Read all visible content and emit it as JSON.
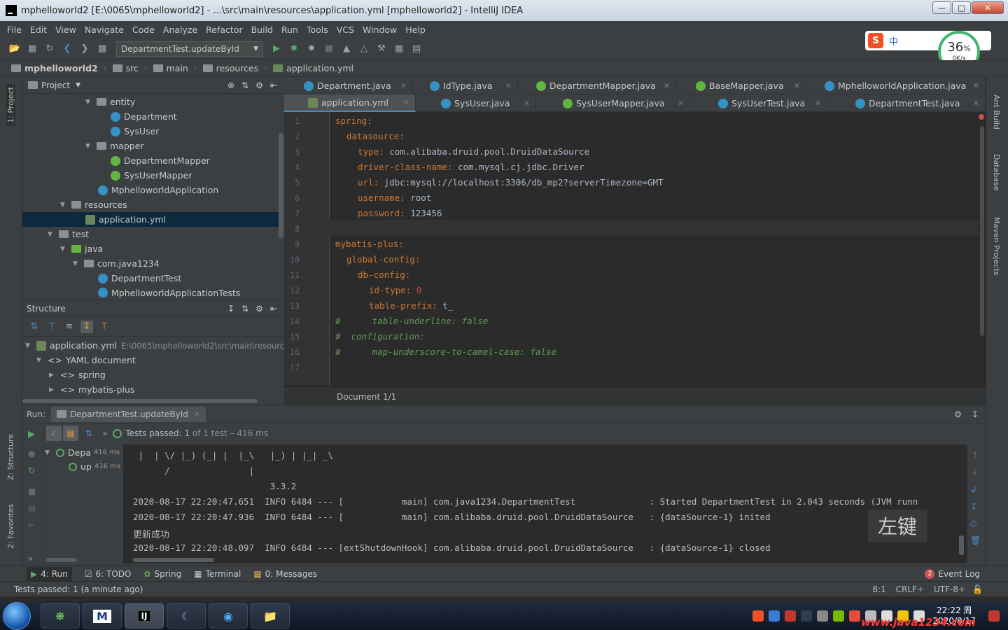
{
  "window": {
    "title": "mphelloworld2 [E:\\0065\\mphelloworld2] - ...\\src\\main\\resources\\application.yml [mphelloworld2] - IntelliJ IDEA",
    "min": "—",
    "max": "□",
    "close": "✕"
  },
  "menu": [
    "File",
    "Edit",
    "View",
    "Navigate",
    "Code",
    "Analyze",
    "Refactor",
    "Build",
    "Run",
    "Tools",
    "VCS",
    "Window",
    "Help"
  ],
  "toolbar": {
    "run_config": "DepartmentTest.updateById"
  },
  "breadcrumb": [
    "mphelloworld2",
    "src",
    "main",
    "resources",
    "application.yml"
  ],
  "left_strip": {
    "project": "1: Project",
    "structure": "Z: Structure",
    "favorites": "2: Favorites"
  },
  "right_strip": {
    "ant": "Ant Build",
    "database": "Database",
    "maven": "Maven Projects"
  },
  "project_panel": {
    "title": "Project",
    "tree": [
      {
        "label": "entity",
        "type": "folder"
      },
      {
        "label": "Department",
        "type": "class"
      },
      {
        "label": "SysUser",
        "type": "class"
      },
      {
        "label": "mapper",
        "type": "folder"
      },
      {
        "label": "DepartmentMapper",
        "type": "interface"
      },
      {
        "label": "SysUserMapper",
        "type": "interface"
      },
      {
        "label": "MphelloworldApplication",
        "type": "class"
      },
      {
        "label": "resources",
        "type": "folder"
      },
      {
        "label": "application.yml",
        "type": "yml"
      },
      {
        "label": "test",
        "type": "folder"
      },
      {
        "label": "java",
        "type": "folder"
      },
      {
        "label": "com.java1234",
        "type": "folder"
      },
      {
        "label": "DepartmentTest",
        "type": "class"
      },
      {
        "label": "MphelloworldApplicationTests",
        "type": "class"
      }
    ]
  },
  "structure_panel": {
    "title": "Structure",
    "root_label": "application.yml",
    "root_path": "E:\\0065\\mphelloworld2\\src\\main\\resourc",
    "doc": "YAML document",
    "children": [
      "spring",
      "mybatis-plus"
    ]
  },
  "editor": {
    "tabs_row1": [
      "Department.java",
      "IdType.java",
      "DepartmentMapper.java",
      "BaseMapper.java",
      "MphelloworldApplication.java"
    ],
    "tabs_row2": [
      "application.yml",
      "SysUser.java",
      "SysUserMapper.java",
      "SysUserTest.java",
      "DepartmentTest.java"
    ],
    "line_numbers": [
      "1",
      "2",
      "3",
      "4",
      "5",
      "6",
      "7",
      "8",
      "9",
      "10",
      "11",
      "12",
      "13",
      "14",
      "15",
      "16",
      "17"
    ],
    "code": {
      "l1_key": "spring:",
      "l2_key": "datasource:",
      "l3_key": "type:",
      "l3_val": " com.alibaba.druid.pool.DruidDataSource",
      "l4_key": "driver-class-name:",
      "l4_val": " com.mysql.cj.jdbc.Driver",
      "l5_key": "url:",
      "l5_val": " jdbc:mysql://localhost:3306/db_mp2?serverTimezone=GMT",
      "l6_key": "username:",
      "l6_val": " root",
      "l7_key": "password:",
      "l7_val": " 123456",
      "l9_key": "mybatis-plus:",
      "l10_key": "global-config:",
      "l11_key": "db-config:",
      "l12_key": "id-type:",
      "l12_val": " 0",
      "l13_key": "table-prefix:",
      "l13_val": " t_",
      "l14": "#      table-underline: false",
      "l15": "#  configuration:",
      "l16": "#      map-underscore-to-camel-case: false"
    },
    "footer": "Document 1/1"
  },
  "run_panel": {
    "label": "Run:",
    "tab": "DepartmentTest.updateById",
    "status_prefix": "Tests passed:",
    "status_count": "1",
    "status_suffix": "of 1 test – 416 ms",
    "tree_root": "Depa",
    "tree_root_time": "416 ms",
    "tree_child": "up",
    "tree_child_time": "416 ms",
    "console": [
      " |  | \\/ |_) (_| |  |_\\   |_) | |_| _\\",
      "      /               |",
      "                          3.3.2",
      "2020-08-17 22:20:47.651  INFO 6484 --- [           main] com.java1234.DepartmentTest              : Started DepartmentTest in 2.043 seconds (JVM runn",
      "2020-08-17 22:20:47.936  INFO 6484 --- [           main] com.alibaba.druid.pool.DruidDataSource   : {dataSource-1} inited",
      "更新成功",
      "2020-08-17 22:20:48.097  INFO 6484 --- [extShutdownHook] com.alibaba.druid.pool.DruidDataSource   : {dataSource-1} closed"
    ]
  },
  "bottom_tools": [
    "4: Run",
    "6: TODO",
    "Spring",
    "Terminal",
    "0: Messages"
  ],
  "event_log": {
    "count": "2",
    "label": "Event Log"
  },
  "statusbar": {
    "message": "Tests passed: 1 (a minute ago)",
    "position": "8:1",
    "line_sep": "CRLF÷",
    "encoding": "UTF-8÷"
  },
  "overlay": {
    "ime_label": "中",
    "speed_percent": "36",
    "speed_unit": "%",
    "speed_rate": "0K/s",
    "hint": "左键"
  },
  "taskbar": {
    "time": "22:22 周",
    "date": "2020/8/17",
    "watermark": "www.java1234.com"
  }
}
